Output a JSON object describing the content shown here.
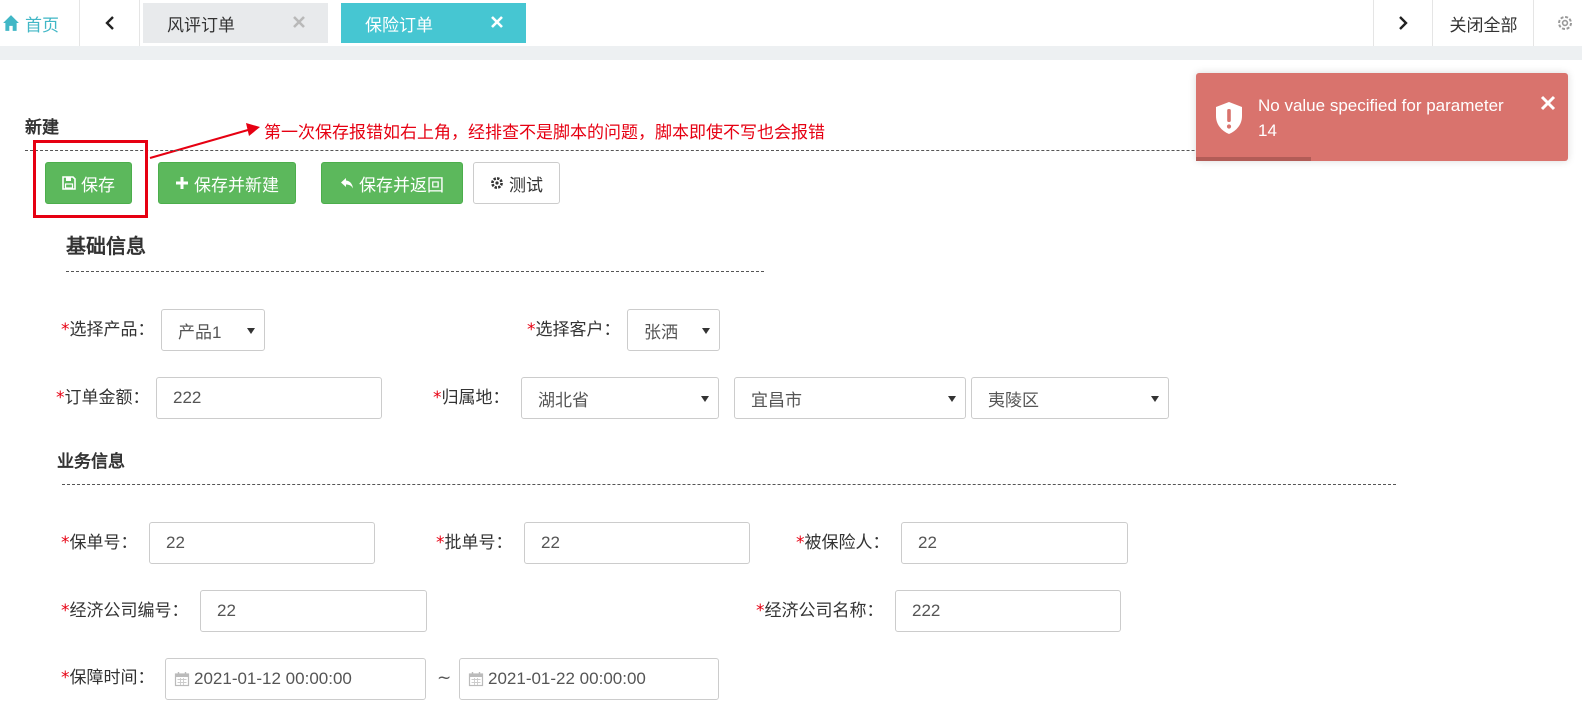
{
  "tabs": {
    "home_label": "首页",
    "items": [
      {
        "label": "风评订单",
        "active": false
      },
      {
        "label": "保险订单",
        "active": true
      }
    ],
    "close_all_label": "关闭全部"
  },
  "page": {
    "title": "新建",
    "annotation": "第一次保存报错如右上角，经排查不是脚本的问题，脚本即使不写也会报错"
  },
  "toolbar": {
    "save_label": "保存",
    "save_new_label": "保存并新建",
    "save_back_label": "保存并返回",
    "test_label": "测试"
  },
  "toast": {
    "message": "No value specified for parameter 14",
    "progress": 0.31,
    "color": "#d9736d"
  },
  "basic": {
    "title": "基础信息",
    "product_label": "选择产品：",
    "product_value": "产品1",
    "customer_label": "选择客户：",
    "customer_value": "张洒",
    "amount_label": "订单金额：",
    "amount_value": "222",
    "region_label": "归属地：",
    "province": "湖北省",
    "city": "宜昌市",
    "district": "夷陵区"
  },
  "business": {
    "title": "业务信息",
    "policy_no_label": "保单号：",
    "policy_no_value": "22",
    "batch_no_label": "批单号：",
    "batch_no_value": "22",
    "insured_label": "被保险人：",
    "insured_value": "22",
    "broker_code_label": "经济公司编号：",
    "broker_code_value": "22",
    "broker_name_label": "经济公司名称：",
    "broker_name_value": "222",
    "period_label": "保障时间：",
    "period_start": "2021-01-12 00:00:00",
    "period_end": "2021-01-22 00:00:00",
    "period_separator": "~"
  },
  "colors": {
    "accent": "#46c6d2",
    "success": "#5cb85c",
    "required": "#e60012"
  }
}
